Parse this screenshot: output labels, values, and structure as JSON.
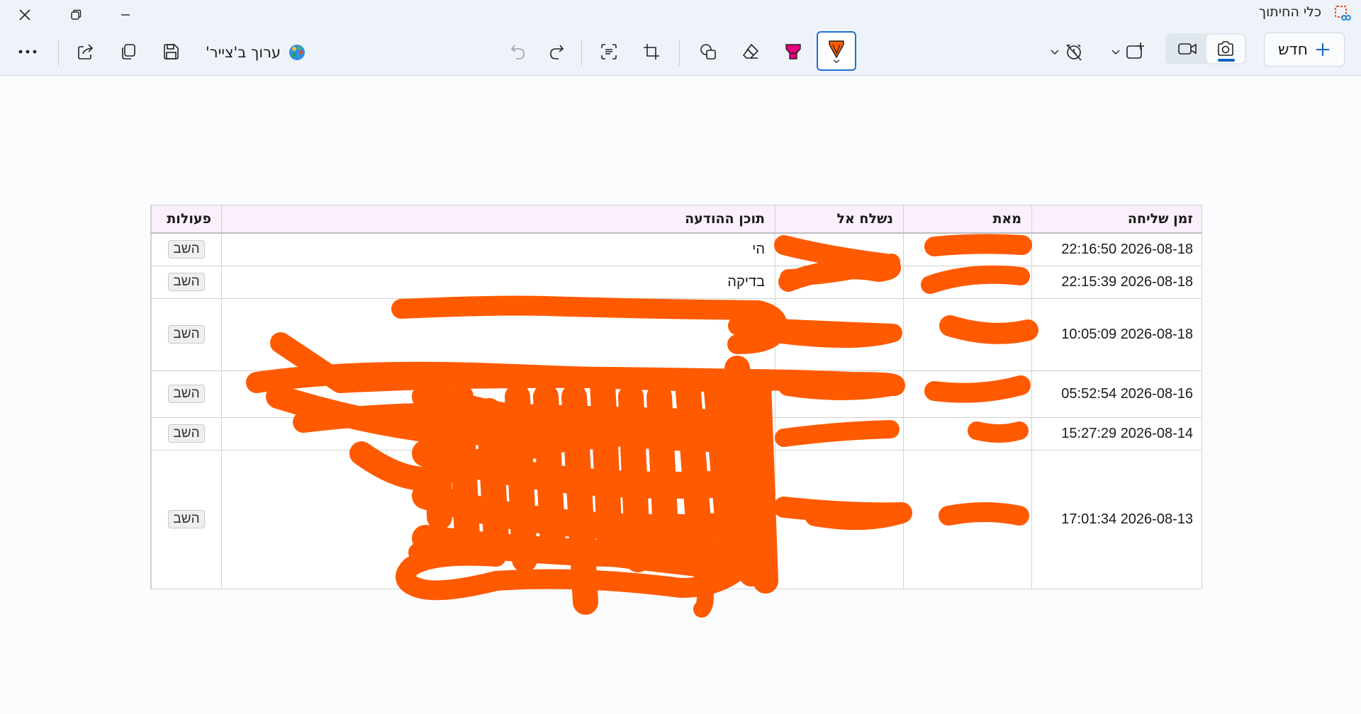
{
  "window": {
    "title": "כלי החיתוך",
    "minimize_icon": "minimize-icon",
    "restore_icon": "restore-icon",
    "close_icon": "close-icon"
  },
  "toolbar": {
    "new_label": "חדש",
    "edit_in_paint_label": "ערוך ב'צייר'",
    "more_icon": "more-icon",
    "share_icon": "share-icon",
    "copy_icon": "copy-icon",
    "save_icon": "save-icon",
    "undo_icon": "undo-icon",
    "redo_icon": "redo-icon",
    "text_actions_icon": "text-actions-icon",
    "crop_icon": "crop-icon",
    "shapes_icon": "shapes-icon",
    "eraser_icon": "eraser-icon",
    "highlighter_icon": "highlighter-icon",
    "pen_icon": "pen-icon",
    "delay_icon": "timer-off-icon",
    "snip_mode_icon": "snip-mode-icon",
    "video_icon": "video-icon",
    "camera_icon": "camera-icon",
    "accent_color": "#1565c0",
    "pen_color": "#ff5a00",
    "highlighter_color": "#e6007e"
  },
  "table": {
    "headers": {
      "time": "זמן שליחה",
      "from": "מאת",
      "to": "נשלח אל",
      "content": "תוכן ההודעה",
      "actions": "פעולות"
    },
    "rows": [
      {
        "time": "2026-08-18 22:16:50",
        "from": "",
        "to": "",
        "content": "הי",
        "action": "השב"
      },
      {
        "time": "2026-08-18 22:15:39",
        "from": "",
        "to": "",
        "content": "בדיקה",
        "action": "השב"
      },
      {
        "time": "2026-08-18 10:05:09",
        "from": "",
        "to": "",
        "content": "",
        "action": "השב"
      },
      {
        "time": "2026-08-16 05:52:54",
        "from": "",
        "to": "",
        "content": "",
        "action": "השב"
      },
      {
        "time": "2026-08-14 15:27:29",
        "from": "",
        "to": "",
        "content": "",
        "action": "השב"
      },
      {
        "time": "2026-08-13 17:01:34",
        "from": "",
        "to": "",
        "content": "",
        "action": "השב"
      }
    ]
  },
  "annotation": {
    "color": "#ff5a00"
  }
}
